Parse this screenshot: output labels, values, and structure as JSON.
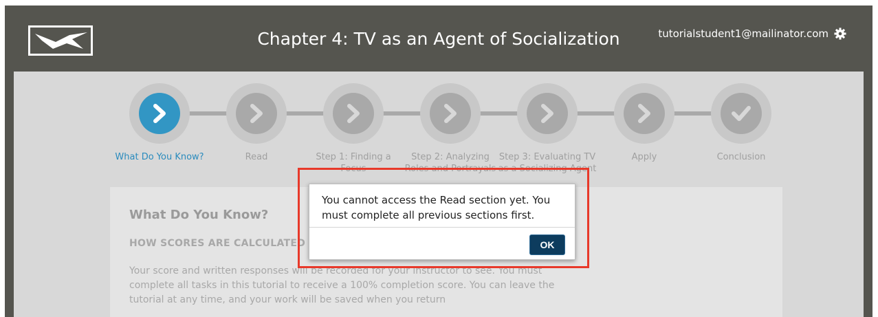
{
  "header": {
    "title": "Chapter 4: TV as an Agent of Socialization",
    "user_email": "tutorialstudent1@mailinator.com",
    "logo_icon": "bird-logo-icon",
    "settings_icon": "gear-icon"
  },
  "steps": [
    {
      "label": "What Do You Know?",
      "icon": "chevron-right-icon",
      "active": true
    },
    {
      "label": "Read",
      "icon": "chevron-right-icon",
      "active": false
    },
    {
      "label": "Step 1: Finding a Focus",
      "icon": "chevron-right-icon",
      "active": false
    },
    {
      "label": "Step 2: Analyzing Roles and Portrayals",
      "icon": "chevron-right-icon",
      "active": false
    },
    {
      "label": "Step 3: Evaluating TV as a Socializing Agent",
      "icon": "chevron-right-icon",
      "active": false
    },
    {
      "label": "Apply",
      "icon": "chevron-right-icon",
      "active": false
    },
    {
      "label": "Conclusion",
      "icon": "checkmark-icon",
      "active": false
    }
  ],
  "card": {
    "title": "What Do You Know?",
    "subtitle": "HOW SCORES ARE CALCULATED",
    "body": "Your score and written responses will be recorded for your instructor to see. You must complete all tasks in this tutorial to receive a 100% completion score. You can leave the tutorial at any time, and your work will be saved when you return"
  },
  "dialog": {
    "message": "You cannot access the Read section yet. You must complete all previous sections first.",
    "ok_label": "OK"
  },
  "colors": {
    "header_bg": "#55554f",
    "active_step": "#3296c4",
    "ok_button": "#0d3c5e",
    "highlight": "#e8392a"
  }
}
